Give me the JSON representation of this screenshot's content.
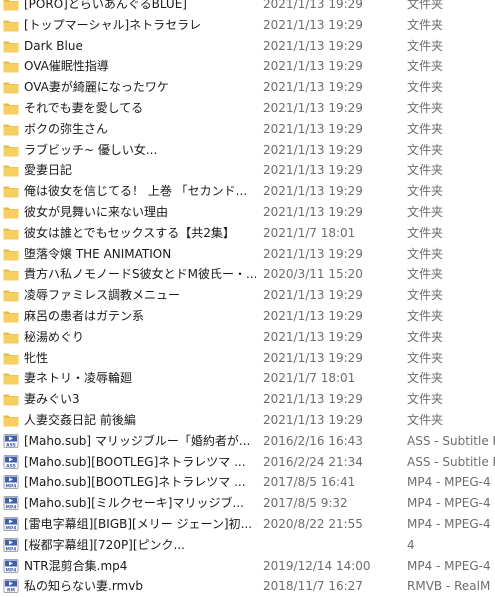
{
  "colors": {
    "folder": "#f6cf5f",
    "folder_dark": "#e7b83a",
    "media_icon": "#3f5fae",
    "text": "#1a1a1a",
    "meta_text": "#6d6d6d"
  },
  "files": [
    {
      "icon": "folder-icon",
      "name": "[PORO]とらいあんぐるBLUE]",
      "date": "2021/1/13 19:29",
      "type": "文件夹"
    },
    {
      "icon": "folder-icon",
      "name": "[トップマーシャル]ネトラセラレ",
      "date": "2021/1/13 19:29",
      "type": "文件夹"
    },
    {
      "icon": "folder-icon",
      "name": "Dark Blue",
      "date": "2021/1/13 19:29",
      "type": "文件夹"
    },
    {
      "icon": "folder-icon",
      "name": "OVA催眠性指導",
      "date": "2021/1/13 19:29",
      "type": "文件夹"
    },
    {
      "icon": "folder-icon",
      "name": "OVA妻が綺麗になったワケ",
      "date": "2021/1/13 19:29",
      "type": "文件夹"
    },
    {
      "icon": "folder-icon",
      "name": "それでも妻を愛してる",
      "date": "2021/1/13 19:29",
      "type": "文件夹"
    },
    {
      "icon": "folder-icon",
      "name": "ボクの弥生さん",
      "date": "2021/1/13 19:29",
      "type": "文件夹"
    },
    {
      "icon": "folder-icon",
      "name": "ラブビッチ~ 優しい女...",
      "date": "2021/1/13 19:29",
      "type": "文件夹"
    },
    {
      "icon": "folder-icon",
      "name": "愛妻日記",
      "date": "2021/1/13 19:29",
      "type": "文件夹"
    },
    {
      "icon": "folder-icon",
      "name": "俺は彼女を信じてる！ 上巻 「セカンド...",
      "date": "2021/1/13 19:29",
      "type": "文件夹"
    },
    {
      "icon": "folder-icon",
      "name": "彼女が見舞いに来ない理由",
      "date": "2021/1/13 19:29",
      "type": "文件夹"
    },
    {
      "icon": "folder-icon",
      "name": "彼女は誰とでもセックスする【共2集】",
      "date": "2021/1/7 18:01",
      "type": "文件夹"
    },
    {
      "icon": "folder-icon",
      "name": "堕落令嬢 THE ANIMATION",
      "date": "2021/1/13 19:29",
      "type": "文件夹"
    },
    {
      "icon": "folder-icon",
      "name": "貴方ハ私ノモノードS彼女とドM彼氏ー・...",
      "date": "2020/3/11 15:20",
      "type": "文件夹"
    },
    {
      "icon": "folder-icon",
      "name": "凌辱ファミレス調教メニュー",
      "date": "2021/1/13 19:29",
      "type": "文件夹"
    },
    {
      "icon": "folder-icon",
      "name": "麻呂の患者はガテン系",
      "date": "2021/1/13 19:29",
      "type": "文件夹"
    },
    {
      "icon": "folder-icon",
      "name": "秘湯めぐり",
      "date": "2021/1/13 19:29",
      "type": "文件夹"
    },
    {
      "icon": "folder-icon",
      "name": "牝性",
      "date": "2021/1/13 19:29",
      "type": "文件夹"
    },
    {
      "icon": "folder-icon",
      "name": "妻ネトリ・凌辱輪廻",
      "date": "2021/1/7 18:01",
      "type": "文件夹"
    },
    {
      "icon": "folder-icon",
      "name": "妻みぐい3",
      "date": "2021/1/13 19:29",
      "type": "文件夹"
    },
    {
      "icon": "folder-icon",
      "name": "人妻交姦日記 前後編",
      "date": "2021/1/13 19:29",
      "type": "文件夹"
    },
    {
      "icon": "ass-subtitle-icon",
      "name": "[Maho.sub] マリッジブルー「婚約者が...",
      "date": "2016/2/16 16:43",
      "type": "ASS - Subtitle F"
    },
    {
      "icon": "ass-subtitle-icon",
      "name": "[Maho.sub][BOOTLEG]ネトラレツマ ...",
      "date": "2016/2/24 21:34",
      "type": "ASS - Subtitle F"
    },
    {
      "icon": "mp4-video-icon",
      "name": "[Maho.sub][BOOTLEG]ネトラレツマ ...",
      "date": "2017/8/5 16:41",
      "type": "MP4 - MPEG-4"
    },
    {
      "icon": "mp4-video-icon",
      "name": "[Maho.sub][ミルクセーキ]マリッジブ...",
      "date": "2017/8/5 9:32",
      "type": "MP4 - MPEG-4"
    },
    {
      "icon": "mp4-video-icon",
      "name": "[雷电字幕组][BIGB][メリー ジェーン]初...",
      "date": "2020/8/22 21:55",
      "type": "MP4 - MPEG-4"
    },
    {
      "icon": "mp4-video-icon",
      "name": "[桜都字幕组][720P][ピンク...",
      "date": "",
      "type": "4"
    },
    {
      "icon": "mp4-video-icon",
      "name": "NTR混剪合集.mp4",
      "date": "2019/12/14 14:00",
      "type": "MP4 - MPEG-4"
    },
    {
      "icon": "rmvb-video-icon",
      "name": "私の知らない妻.rmvb",
      "date": "2018/11/7 16:27",
      "type": "RMVB - RealM"
    }
  ]
}
